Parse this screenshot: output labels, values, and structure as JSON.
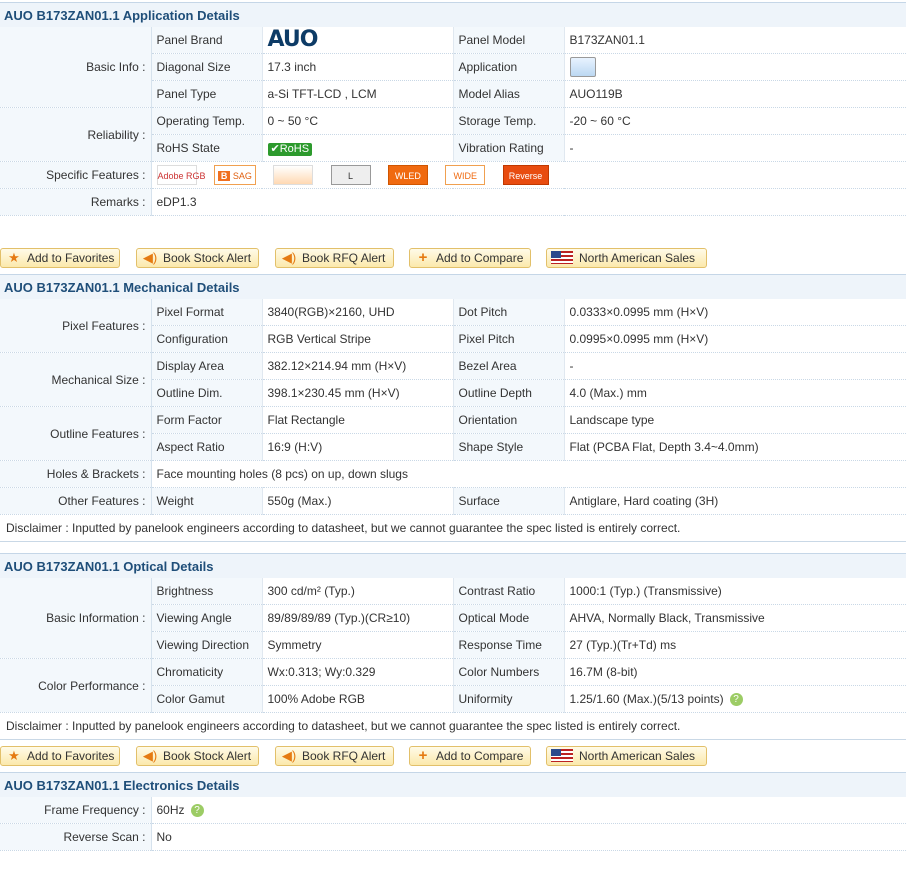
{
  "buttons": {
    "favorites": "Add to Favorites",
    "stock_alert": "Book Stock Alert",
    "rfq_alert": "Book RFQ Alert",
    "compare": "Add to Compare",
    "sales": "North American Sales"
  },
  "application": {
    "title": "AUO B173ZAN01.1 Application Details",
    "basic_info": "Basic Info :",
    "panel_brand_label": "Panel Brand",
    "brand_logo": "AUO",
    "panel_model_label": "Panel Model",
    "panel_model": "B173ZAN01.1",
    "diagonal_label": "Diagonal Size",
    "diagonal": "17.3 inch",
    "application_label": "Application",
    "panel_type_label": "Panel Type",
    "panel_type": "a-Si TFT-LCD , LCM",
    "model_alias_label": "Model Alias",
    "model_alias": "AUO119B",
    "reliability": "Reliability :",
    "op_temp_label": "Operating Temp.",
    "op_temp": "0 ~ 50 °C",
    "storage_label": "Storage Temp.",
    "storage": "-20 ~ 60 °C",
    "rohs_label": "RoHS State",
    "rohs": "RoHS",
    "vibration_label": "Vibration Rating",
    "vibration": "-",
    "specific_features": "Specific Features :",
    "features": [
      "Adobe RGB",
      "SAG",
      "",
      "L",
      "WLED",
      "WIDE",
      "Reverse"
    ],
    "remarks_label": "Remarks :",
    "remarks": "eDP1.3"
  },
  "mechanical": {
    "title": "AUO B173ZAN01.1 Mechanical Details",
    "pixel_features": "Pixel Features :",
    "pixel_format_label": "Pixel Format",
    "pixel_format": "3840(RGB)×2160, UHD",
    "dot_pitch_label": "Dot Pitch",
    "dot_pitch": "0.0333×0.0995 mm (H×V)",
    "config_label": "Configuration",
    "config": "RGB Vertical Stripe",
    "pixel_pitch_label": "Pixel Pitch",
    "pixel_pitch": "0.0995×0.0995 mm (H×V)",
    "mech_size": "Mechanical Size :",
    "display_area_label": "Display Area",
    "display_area": "382.12×214.94 mm (H×V)",
    "bezel_label": "Bezel Area",
    "bezel": "-",
    "outline_dim_label": "Outline Dim.",
    "outline_dim": "398.1×230.45 mm (H×V)",
    "outline_depth_label": "Outline Depth",
    "outline_depth": "4.0 (Max.) mm",
    "outline_features": "Outline Features :",
    "form_label": "Form Factor",
    "form": "Flat Rectangle",
    "orientation_label": "Orientation",
    "orientation": "Landscape type",
    "aspect_label": "Aspect Ratio",
    "aspect": "16:9 (H:V)",
    "shape_label": "Shape Style",
    "shape": "Flat (PCBA Flat, Depth 3.4~4.0mm)",
    "holes_label": "Holes & Brackets :",
    "holes": "Face mounting holes (8 pcs) on up, down slugs",
    "other_label": "Other Features :",
    "weight_label": "Weight",
    "weight": "550g (Max.)",
    "surface_label": "Surface",
    "surface": "Antiglare, Hard coating (3H)",
    "disclaimer": "Disclaimer : Inputted by panelook engineers according to datasheet, but we cannot guarantee the spec listed is entirely correct."
  },
  "optical": {
    "title": "AUO B173ZAN01.1 Optical Details",
    "basic_information": "Basic Information :",
    "brightness_label": "Brightness",
    "brightness": "300 cd/m² (Typ.)",
    "contrast_label": "Contrast Ratio",
    "contrast": "1000:1 (Typ.) (Transmissive)",
    "viewing_angle_label": "Viewing Angle",
    "viewing_angle": "89/89/89/89 (Typ.)(CR≥10)",
    "optical_mode_label": "Optical Mode",
    "optical_mode": "AHVA, Normally Black, Transmissive",
    "viewing_dir_label": "Viewing Direction",
    "viewing_dir": "Symmetry",
    "response_label": "Response Time",
    "response": "27 (Typ.)(Tr+Td) ms",
    "color_perf": "Color Performance :",
    "chroma_label": "Chromaticity",
    "chroma": "Wx:0.313; Wy:0.329",
    "color_numbers_label": "Color Numbers",
    "color_numbers": "16.7M (8-bit)",
    "gamut_label": "Color Gamut",
    "gamut": "100% Adobe RGB",
    "uniformity_label": "Uniformity",
    "uniformity": "1.25/1.60 (Max.)(5/13 points)",
    "disclaimer": "Disclaimer : Inputted by panelook engineers according to datasheet, but we cannot guarantee the spec listed is entirely correct."
  },
  "electronics": {
    "title": "AUO B173ZAN01.1 Electronics Details",
    "frame_label": "Frame Frequency :",
    "frame": "60Hz",
    "reverse_label": "Reverse Scan :",
    "reverse": "No"
  }
}
